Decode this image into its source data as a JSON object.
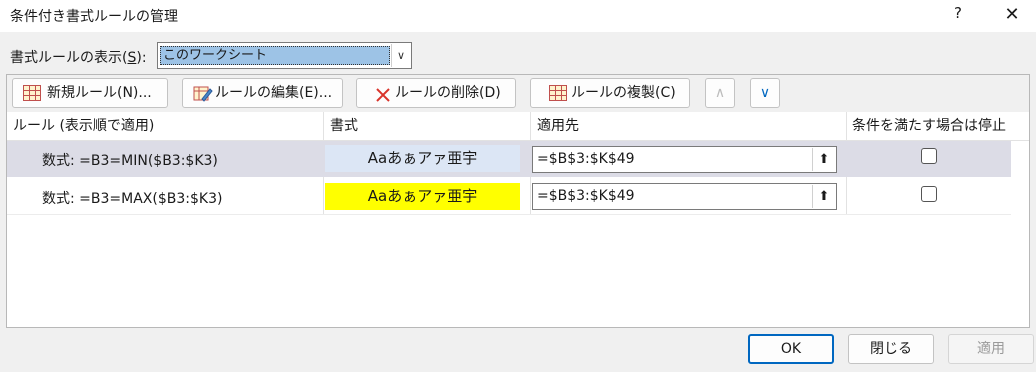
{
  "window": {
    "title": "条件付き書式ルールの管理",
    "help_glyph": "?",
    "close_glyph": "✕"
  },
  "show_rules": {
    "label_prefix": "書式ルールの表示(",
    "label_key": "S",
    "label_suffix": "):",
    "selected": "このワークシート"
  },
  "toolbar": {
    "new_rule": "新規ルール(N)...",
    "edit_rule": "ルールの編集(E)...",
    "delete_rule": "ルールの削除(D)",
    "duplicate_rule": "ルールの複製(C)"
  },
  "table": {
    "headers": [
      "ルール (表示順で適用)",
      "書式",
      "適用先",
      "条件を満たす場合は停止"
    ],
    "rows": [
      {
        "rule": "数式: =B3=MIN($B3:$K3)",
        "format_preview": "Aaあぁアァ亜宇",
        "applies_to": "=$B$3:$K$49",
        "stop_if_true": false,
        "preview_bg": "#dce6f5",
        "selected": true
      },
      {
        "rule": "数式: =B3=MAX($B3:$K3)",
        "format_preview": "Aaあぁアァ亜宇",
        "applies_to": "=$B$3:$K$49",
        "stop_if_true": false,
        "preview_bg": "#ffff00",
        "selected": false
      }
    ]
  },
  "footer": {
    "ok": "OK",
    "close": "閉じる",
    "apply": "適用"
  },
  "colors": {
    "accent": "#0067c0",
    "selected_row": "#dcdce6",
    "delete_icon": "#d9342b"
  }
}
